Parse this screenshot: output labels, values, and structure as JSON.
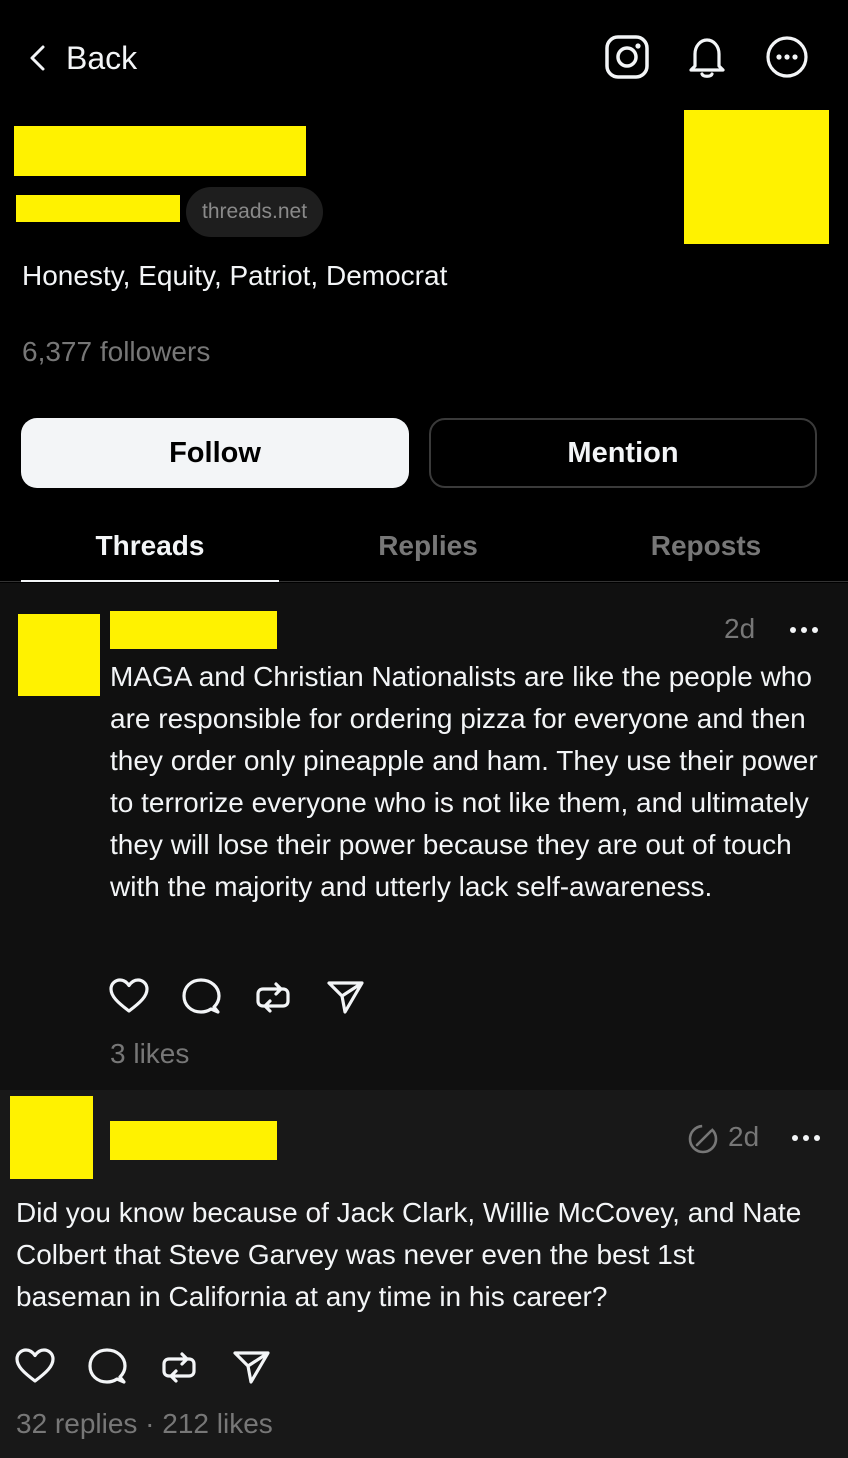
{
  "header": {
    "back_label": "Back",
    "icons": [
      "instagram-icon",
      "bell-icon",
      "more-circle-icon"
    ]
  },
  "profile": {
    "domain": "threads.net",
    "bio": "Honesty, Equity, Patriot, Democrat",
    "followers": "6,377 followers",
    "redaction_color": "#fff200"
  },
  "buttons": {
    "follow": "Follow",
    "mention": "Mention"
  },
  "tabs": [
    {
      "label": "Threads",
      "active": true
    },
    {
      "label": "Replies",
      "active": false
    },
    {
      "label": "Reposts",
      "active": false
    }
  ],
  "posts": [
    {
      "time": "2d",
      "edited": false,
      "text": "MAGA and Christian Nationalists are like the people who are responsible for ordering pizza for everyone and then they order only pineapple and ham.  They use their power to terrorize everyone who is not like them, and ultimately they will lose their power because they are out of touch with the majority and utterly lack self-awareness.",
      "stats": "3 likes"
    },
    {
      "time": "2d",
      "edited": true,
      "text": "Did you know because of Jack Clark, Willie McCovey, and Nate Colbert that Steve Garvey was never even the best 1st baseman in California at any time in his career?",
      "stats": "32 replies · 212 likes"
    }
  ]
}
